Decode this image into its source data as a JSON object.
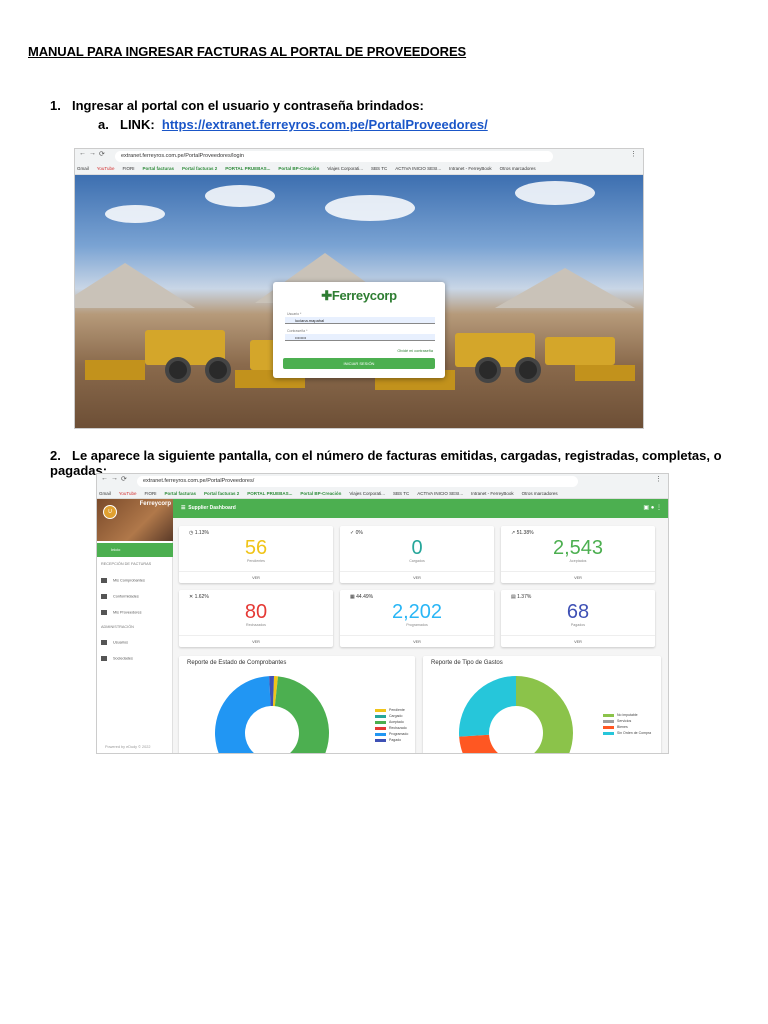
{
  "doc": {
    "title": "MANUAL PARA INGRESAR FACTURAS AL PORTAL DE PROVEEDORES",
    "step1": {
      "num": "1.",
      "text": "Ingresar al portal con el usuario y contraseña brindados:"
    },
    "step1a": {
      "label": "a.",
      "prefix": "LINK:",
      "link": "https://extranet.ferreyros.com.pe/PortalProveedores/"
    },
    "step2": {
      "num": "2.",
      "text": "Le aparece la siguiente pantalla, con el número de facturas emitidas, cargadas, registradas, completas, o pagadas:"
    }
  },
  "login_shot": {
    "url": "extranet.ferreyros.com.pe/PortalProveedores/login",
    "bookmarks": [
      "Gmail",
      "YouTube",
      "FIORI",
      "Portal facturas",
      "Portal facturas 2",
      "PORTAL PRUEBAS...",
      "Portal BP-Creación",
      "Viajes Corporati...",
      "SBS TC",
      "ACTIVA INICIO SESI...",
      "Intranet - FerreyBook",
      "Otros marcadores"
    ],
    "brand": "Ferreycorp",
    "user_label": "Usuario *",
    "user_value": "luciana.mapahal",
    "pass_label": "Contraseña *",
    "pass_value": "••••••••",
    "forgot": "Olvidé mi contraseña",
    "button": "INICIAR SESIÓN"
  },
  "dash_shot": {
    "url": "extranet.ferreyros.com.pe/PortalProveedores/",
    "brand": "Ferreycorp",
    "topbar_title": "Supplier Dashboard",
    "menu_home": "Inicio",
    "section_receipt": "RECEPCIÓN DE FACTURAS",
    "items_receipt": [
      "Mis Comprobantes",
      "Conformidades",
      "Mis Proveedores"
    ],
    "section_admin": "ADMINISTRACIÓN",
    "items_admin": [
      "Usuarios",
      "Sociedades"
    ],
    "footer": "Powered by eDudy © 2022",
    "cards": [
      {
        "pct": "1.13%",
        "value": "56",
        "caption": "Pendientes",
        "action": "VER",
        "color": "#f0c419",
        "icon": "clock-icon"
      },
      {
        "pct": "0%",
        "value": "0",
        "caption": "Cargados",
        "action": "VER",
        "color": "#26a69a",
        "icon": "check-icon"
      },
      {
        "pct": "51.38%",
        "value": "2,543",
        "caption": "Aceptados",
        "action": "VER",
        "color": "#4caf50",
        "icon": "trend-icon"
      },
      {
        "pct": "1.62%",
        "value": "80",
        "caption": "Rechazados",
        "action": "VER",
        "color": "#e53935",
        "icon": "close-icon"
      },
      {
        "pct": "44.49%",
        "value": "2,202",
        "caption": "Programados",
        "action": "VER",
        "color": "#29b6f6",
        "icon": "calendar-icon"
      },
      {
        "pct": "1.37%",
        "value": "68",
        "caption": "Pagados",
        "action": "VER",
        "color": "#3f51b5",
        "icon": "money-icon"
      }
    ]
  },
  "chart_data": [
    {
      "type": "pie",
      "title": "Reporte de Estado de Comprobantes",
      "categories": [
        "Pendiente",
        "Cargado",
        "Aceptado",
        "Rechazado",
        "Programado",
        "Pagado"
      ],
      "values": [
        1.13,
        0,
        51.38,
        1.62,
        44.49,
        1.37
      ],
      "colors": [
        "#f0c419",
        "#26a69a",
        "#4caf50",
        "#e53935",
        "#2196f3",
        "#3f51b5"
      ]
    },
    {
      "type": "pie",
      "title": "Reporte de Tipo de Gastos",
      "categories": [
        "No imputable",
        "Servicios",
        "Bienes",
        "Sin Orden de Compra"
      ],
      "values": [
        50,
        0,
        24,
        26
      ],
      "colors": [
        "#8bc34a",
        "#9e9e9e",
        "#ff5722",
        "#26c6da"
      ]
    }
  ]
}
